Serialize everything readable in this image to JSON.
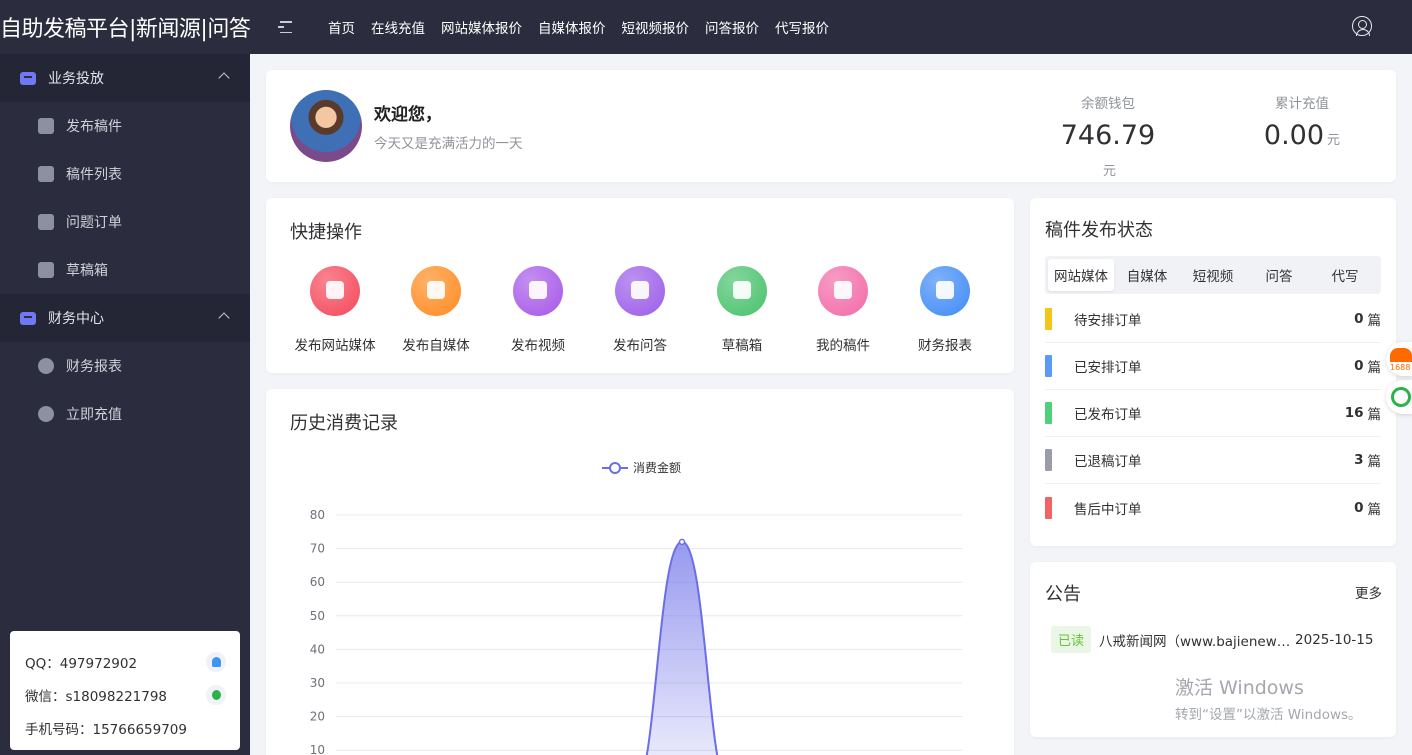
{
  "header": {
    "brand": "自助发稿平台|新闻源|问答",
    "nav": [
      "首页",
      "在线充值",
      "网站媒体报价",
      "自媒体报价",
      "短视频报价",
      "问答报价",
      "代写报价"
    ]
  },
  "sidebar": {
    "groups": [
      {
        "label": "业务投放",
        "items": [
          "发布稿件",
          "稿件列表",
          "问题订单",
          "草稿箱"
        ]
      },
      {
        "label": "财务中心",
        "items": [
          "财务报表",
          "立即充值"
        ]
      }
    ],
    "contact": {
      "qq": "QQ：497972902",
      "wechat": "微信：s18098221798",
      "phone": "手机号码：15766659709"
    }
  },
  "welcome": {
    "title": "欢迎您，",
    "subtitle": "今天又是充满活力的一天",
    "balance_label": "余额钱包",
    "balance_value": "746.79",
    "balance_unit": "元",
    "recharge_label": "累计充值",
    "recharge_value": "0.00",
    "recharge_unit": "元"
  },
  "quick": {
    "title": "快捷操作",
    "actions": [
      {
        "label": "发布网站媒体",
        "color": "#f5475a"
      },
      {
        "label": "发布自媒体",
        "color": "#ff8a1f"
      },
      {
        "label": "发布视频",
        "color": "#a657e8"
      },
      {
        "label": "发布问答",
        "color": "#9b5ce9"
      },
      {
        "label": "草稿箱",
        "color": "#47c26b"
      },
      {
        "label": "我的稿件",
        "color": "#f26aa7"
      },
      {
        "label": "财务报表",
        "color": "#3f8bf5"
      }
    ]
  },
  "history": {
    "title": "历史消费记录",
    "legend": "消费金额"
  },
  "chart_data": {
    "type": "area",
    "series": [
      {
        "name": "消费金额",
        "values": [
          0,
          72,
          0
        ]
      }
    ],
    "y_ticks": [
      "80",
      "70",
      "60",
      "50",
      "40",
      "30",
      "20",
      "10"
    ],
    "ylim": [
      0,
      80
    ],
    "grid": true,
    "legend_position": "top-center",
    "color": "#6b6ee8"
  },
  "status": {
    "title": "稿件发布状态",
    "tabs": [
      "网站媒体",
      "自媒体",
      "短视频",
      "问答",
      "代写"
    ],
    "active_tab": "网站媒体",
    "unit": "篇",
    "rows": [
      {
        "label": "待安排订单",
        "value": "0",
        "color": "#f5c518"
      },
      {
        "label": "已安排订单",
        "value": "0",
        "color": "#5a9cf5"
      },
      {
        "label": "已发布订单",
        "value": "16",
        "color": "#4fd07a"
      },
      {
        "label": "已退稿订单",
        "value": "3",
        "color": "#9a9da8"
      },
      {
        "label": "售后中订单",
        "value": "0",
        "color": "#f26464"
      }
    ]
  },
  "notice": {
    "title": "公告",
    "more": "更多",
    "items": [
      {
        "badge": "已读",
        "text": "八戒新闻网（www.bajienews.com）",
        "date": "2025-10-15"
      }
    ]
  },
  "watermark": {
    "line1": "激活 Windows",
    "line2": "转到“设置”以激活 Windows。"
  },
  "float": {
    "badge_1688": "1688"
  }
}
